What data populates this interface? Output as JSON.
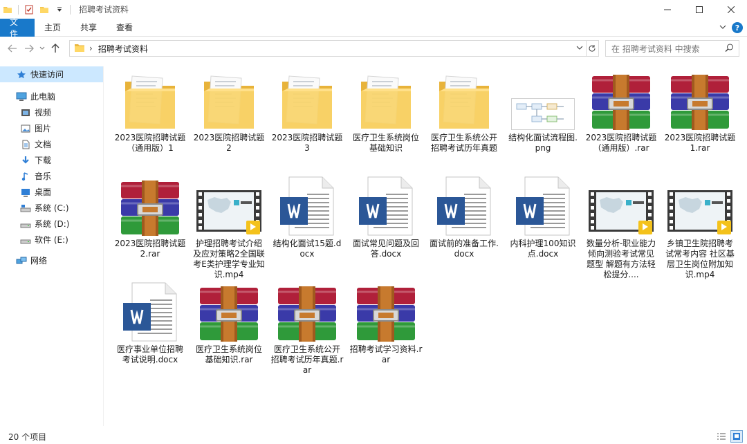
{
  "window": {
    "title": "招聘考试资料"
  },
  "ribbon": {
    "tabs": [
      {
        "label": "文件"
      },
      {
        "label": "主页"
      },
      {
        "label": "共享"
      },
      {
        "label": "查看"
      }
    ]
  },
  "address": {
    "path": "招聘考试资料",
    "search_placeholder": "在 招聘考试资料 中搜索"
  },
  "sidebar": {
    "items": [
      {
        "label": "快速访问",
        "icon": "star-icon"
      },
      {
        "label": "此电脑",
        "icon": "computer-icon"
      },
      {
        "label": "视频",
        "icon": "video-icon"
      },
      {
        "label": "图片",
        "icon": "pictures-icon"
      },
      {
        "label": "文档",
        "icon": "documents-icon"
      },
      {
        "label": "下载",
        "icon": "download-icon"
      },
      {
        "label": "音乐",
        "icon": "music-icon"
      },
      {
        "label": "桌面",
        "icon": "desktop-icon"
      },
      {
        "label": "系统 (C:)",
        "icon": "drive-icon"
      },
      {
        "label": "系统 (D:)",
        "icon": "drive-icon"
      },
      {
        "label": "软件 (E:)",
        "icon": "drive-icon"
      },
      {
        "label": "网络",
        "icon": "network-icon"
      }
    ]
  },
  "files": [
    {
      "name": "2023医院招聘试题（通用版）1",
      "type": "folder"
    },
    {
      "name": "2023医院招聘试题2",
      "type": "folder"
    },
    {
      "name": "2023医院招聘试题3",
      "type": "folder"
    },
    {
      "name": "医疗卫生系统岗位基础知识",
      "type": "folder"
    },
    {
      "name": "医疗卫生系统公开招聘考试历年真题",
      "type": "folder"
    },
    {
      "name": "结构化面试流程图.png",
      "type": "image"
    },
    {
      "name": "2023医院招聘试题（通用版）.rar",
      "type": "rar"
    },
    {
      "name": "2023医院招聘试题1.rar",
      "type": "rar"
    },
    {
      "name": "2023医院招聘试题2.rar",
      "type": "rar"
    },
    {
      "name": "护理招聘考试介绍及应对策略2全国联考E类护理学专业知识.mp4",
      "type": "video"
    },
    {
      "name": "结构化面试15题.docx",
      "type": "docx"
    },
    {
      "name": "面试常见问题及回答.docx",
      "type": "docx"
    },
    {
      "name": "面试前的准备工作.docx",
      "type": "docx"
    },
    {
      "name": "内科护理100知识点.docx",
      "type": "docx"
    },
    {
      "name": "数量分析-职业能力倾向测验考试常见题型 解题有方法轻松提分....",
      "type": "video"
    },
    {
      "name": "乡镇卫生院招聘考试常考内容 社区基层卫生岗位附加知识.mp4",
      "type": "video"
    },
    {
      "name": "医疗事业单位招聘考试说明.docx",
      "type": "docx"
    },
    {
      "name": "医疗卫生系统岗位基础知识.rar",
      "type": "rar"
    },
    {
      "name": "医疗卫生系统公开招聘考试历年真题.rar",
      "type": "rar"
    },
    {
      "name": "招聘考试学习资料.rar",
      "type": "rar"
    }
  ],
  "status": {
    "item_count": "20 个项目"
  },
  "colors": {
    "accent": "#1979ca",
    "folder": "#f5c852",
    "word": "#2b5797",
    "selection": "#cce8ff"
  }
}
